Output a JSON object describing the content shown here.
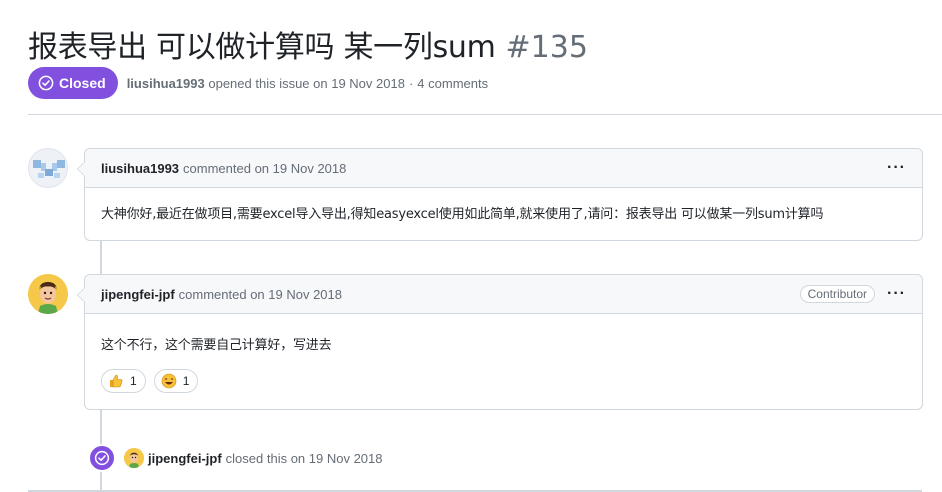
{
  "issue": {
    "title": "报表导出 可以做计算吗 某一列sum",
    "number": "#135",
    "state": "Closed",
    "author": "liusihua1993",
    "opened_text": "opened this issue on 19 Nov 2018",
    "separator": "·",
    "comments_count": "4 comments"
  },
  "comments": [
    {
      "author": "liusihua1993",
      "action": "commented on 19 Nov 2018",
      "role": "",
      "body": "大神你好,最近在做项目,需要excel导入导出,得知easyexcel使用如此简单,就来使用了,请问：报表导出 可以做某一列sum计算吗",
      "more": "···"
    },
    {
      "author": "jipengfei-jpf",
      "action": "commented on 19 Nov 2018",
      "role": "Contributor",
      "body": "这个不行，这个需要自己计算好，写进去",
      "more": "···",
      "reactions": [
        {
          "icon": "thumbs-up-icon",
          "count": "1"
        },
        {
          "icon": "laugh-icon",
          "count": "1"
        }
      ]
    }
  ],
  "event": {
    "icon": "check-circle-icon",
    "actor": "jipengfei-jpf",
    "text": "closed this on 19 Nov 2018"
  },
  "colors": {
    "closed_purple": "#8250df",
    "border": "#d0d7de",
    "muted_text": "#656d76"
  }
}
